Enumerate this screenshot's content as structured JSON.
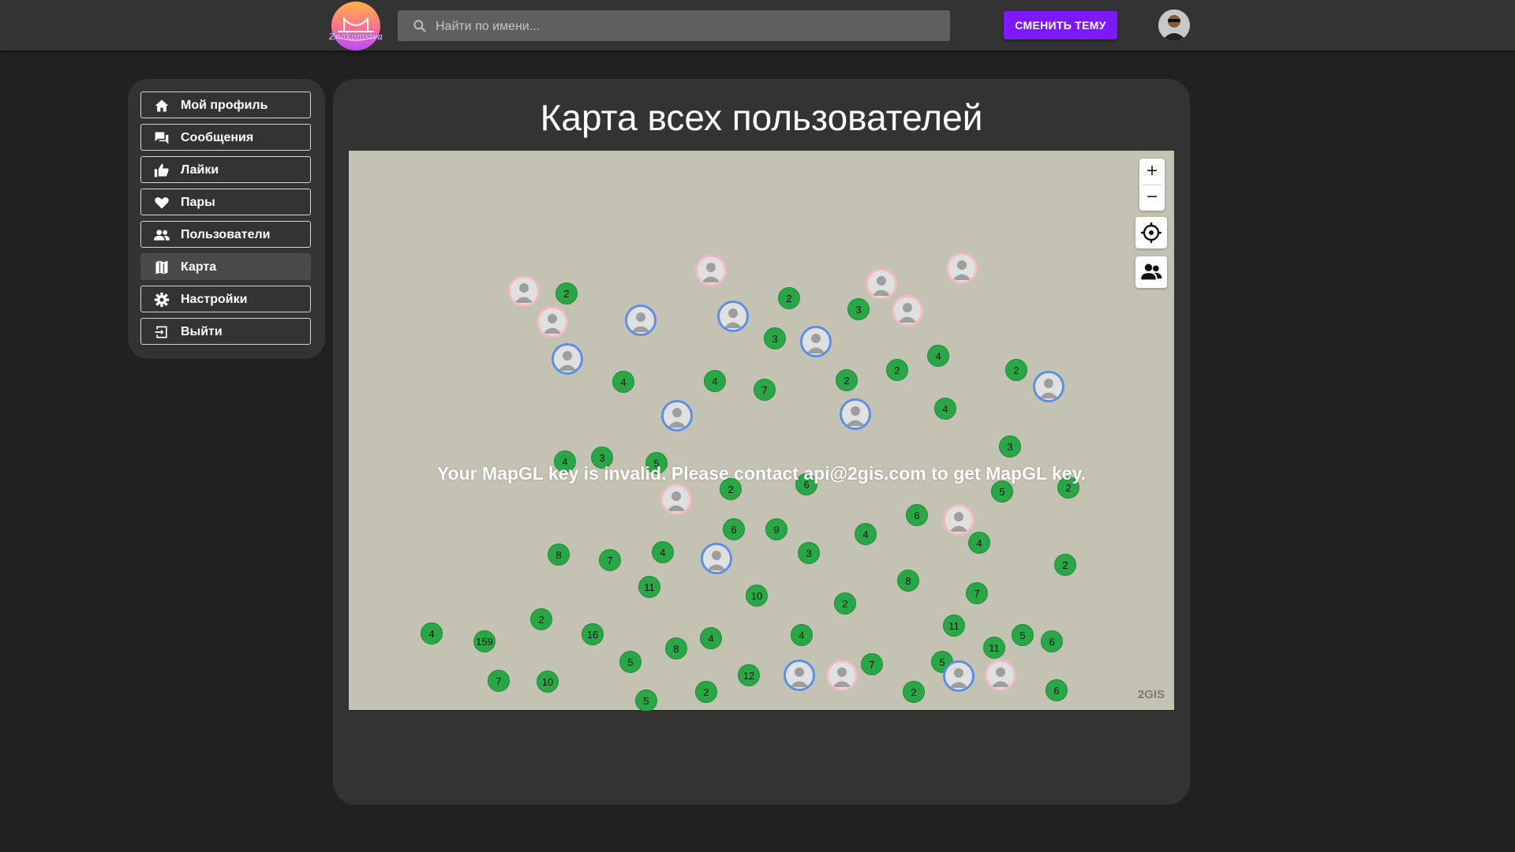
{
  "header": {
    "logo_text": "Znakomstva",
    "search_placeholder": "Найти по имени...",
    "theme_button": "СМЕНИТЬ ТЕМУ"
  },
  "sidebar": {
    "items": [
      {
        "label": "Мой профиль",
        "icon": "home-icon"
      },
      {
        "label": "Сообщения",
        "icon": "chat-icon"
      },
      {
        "label": "Лайки",
        "icon": "thumb-up-icon"
      },
      {
        "label": "Пары",
        "icon": "heart-icon"
      },
      {
        "label": "Пользователи",
        "icon": "people-icon"
      },
      {
        "label": "Карта",
        "icon": "map-icon",
        "active": true
      },
      {
        "label": "Настройки",
        "icon": "gear-icon"
      },
      {
        "label": "Выйти",
        "icon": "logout-icon"
      }
    ]
  },
  "main": {
    "title": "Карта всех пользователей"
  },
  "map": {
    "error_message": "Your MapGL key is invalid. Please contact api@2gis.com to get MapGL key.",
    "brand": "2GIS",
    "zoom_in": "+",
    "zoom_out": "−",
    "cluster_counts": [
      "2",
      "2",
      "3",
      "3",
      "4",
      "4",
      "7",
      "2",
      "2",
      "4",
      "2",
      "4",
      "3",
      "4",
      "3",
      "5",
      "6",
      "2",
      "5",
      "2",
      "6",
      "9",
      "4",
      "6",
      "4",
      "8",
      "7",
      "4",
      "11",
      "3",
      "10",
      "2",
      "8",
      "7",
      "2",
      "4",
      "2",
      "159",
      "16",
      "5",
      "7",
      "10",
      "8",
      "4",
      "11",
      "5",
      "6",
      "12",
      "7",
      "11",
      "5",
      "6",
      "2",
      "5",
      "2",
      "4"
    ],
    "colors": {
      "map_background": "#c4c3b3",
      "cluster": "#29a746",
      "male_pin": "#5b8ee6",
      "female_pin": "#f5b9c2"
    }
  }
}
